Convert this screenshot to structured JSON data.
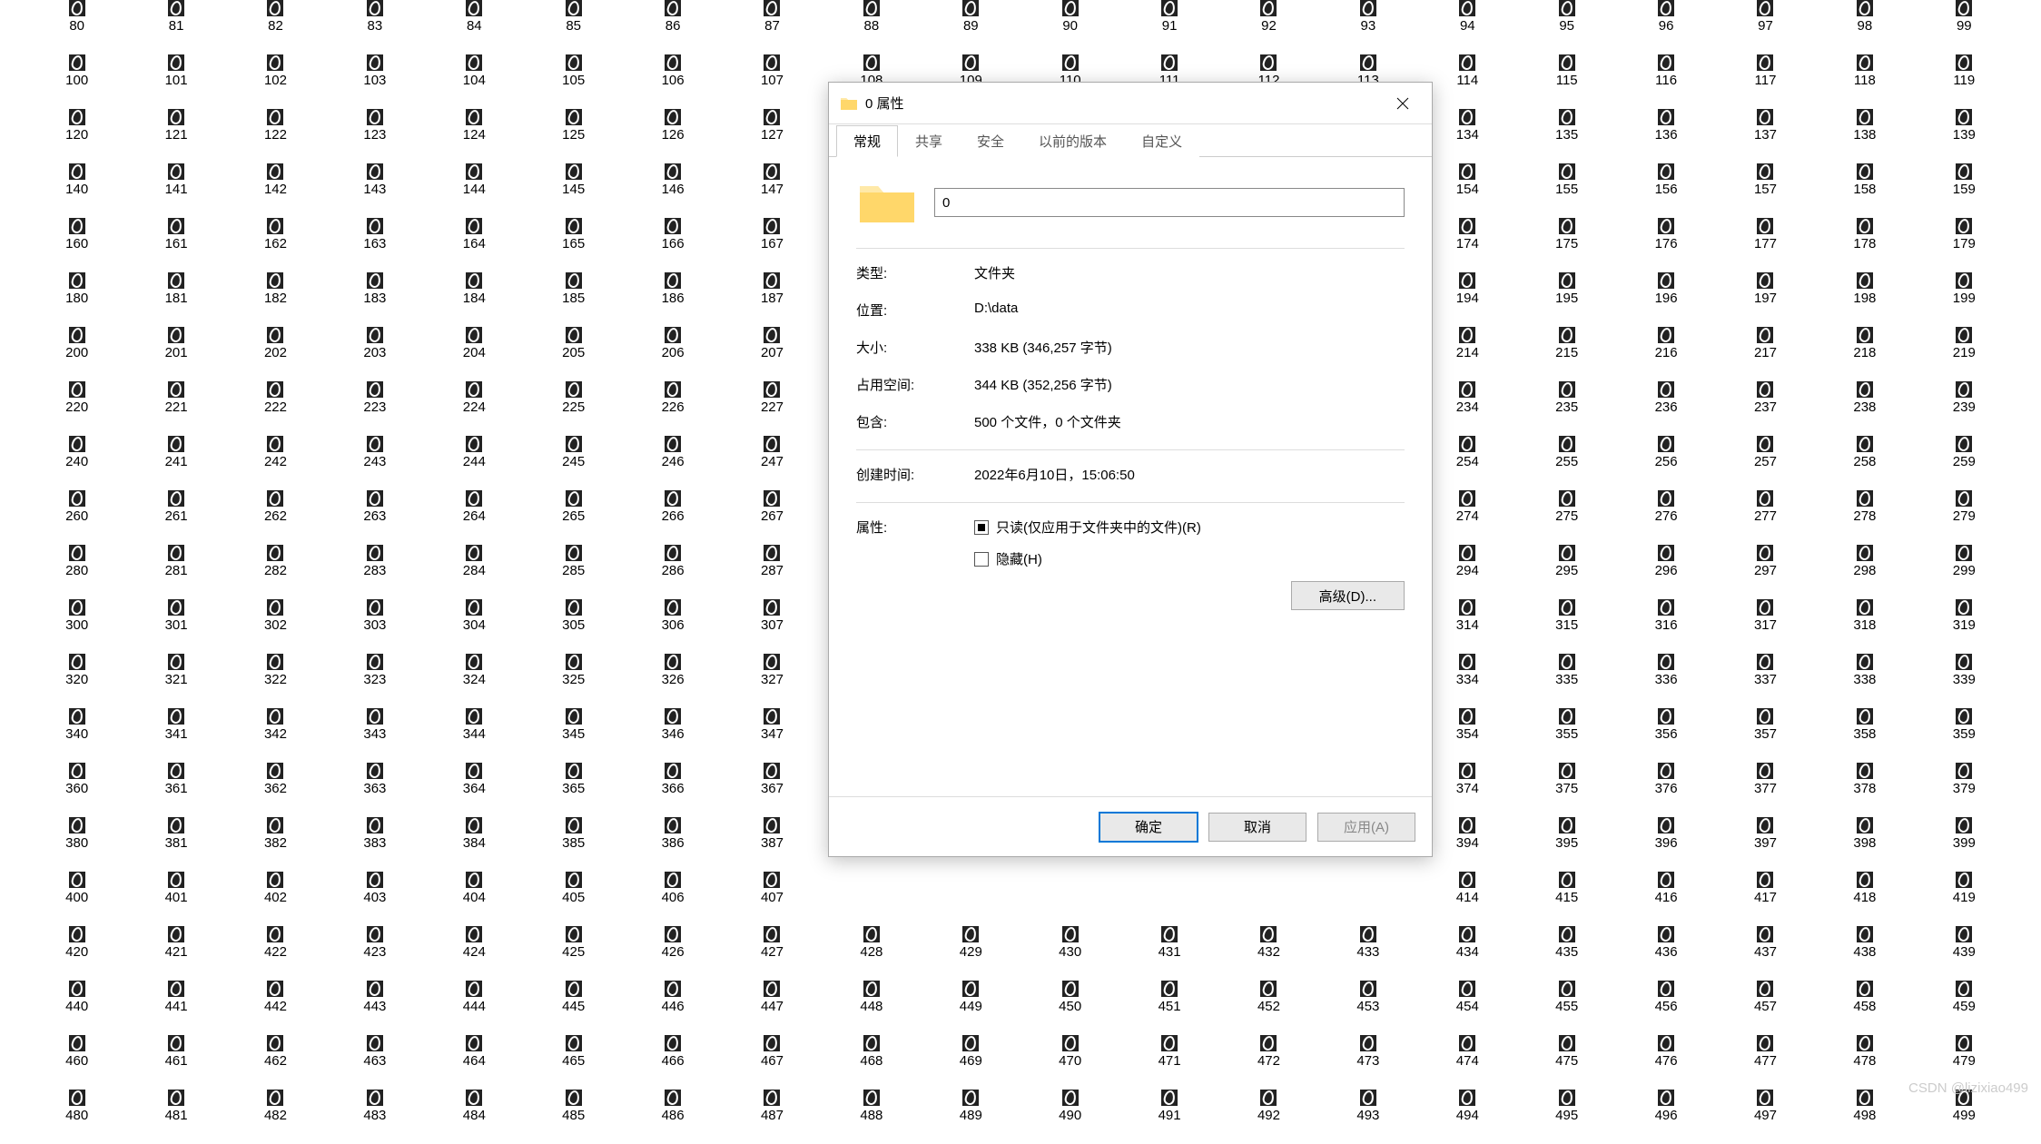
{
  "grid": {
    "start": 80,
    "end": 499
  },
  "gap_rows": {
    "start": 188,
    "end": 413,
    "col_start": 8,
    "col_end": 13
  },
  "dialog": {
    "title": "0 属性",
    "tabs": [
      "常规",
      "共享",
      "安全",
      "以前的版本",
      "自定义"
    ],
    "active_tab": 0,
    "name_value": "0",
    "rows": {
      "type_label": "类型:",
      "type_value": "文件夹",
      "loc_label": "位置:",
      "loc_value": "D:\\data",
      "size_label": "大小:",
      "size_value": "338 KB (346,257 字节)",
      "disk_label": "占用空间:",
      "disk_value": "344 KB (352,256 字节)",
      "contains_label": "包含:",
      "contains_value": "500 个文件，0 个文件夹",
      "created_label": "创建时间:",
      "created_value": "2022年6月10日，15:06:50",
      "attr_label": "属性:",
      "readonly": "只读(仅应用于文件夹中的文件)(R)",
      "hidden": "隐藏(H)",
      "advanced": "高级(D)..."
    },
    "buttons": {
      "ok": "确定",
      "cancel": "取消",
      "apply": "应用(A)"
    }
  },
  "watermark": "CSDN @lizixiao499"
}
